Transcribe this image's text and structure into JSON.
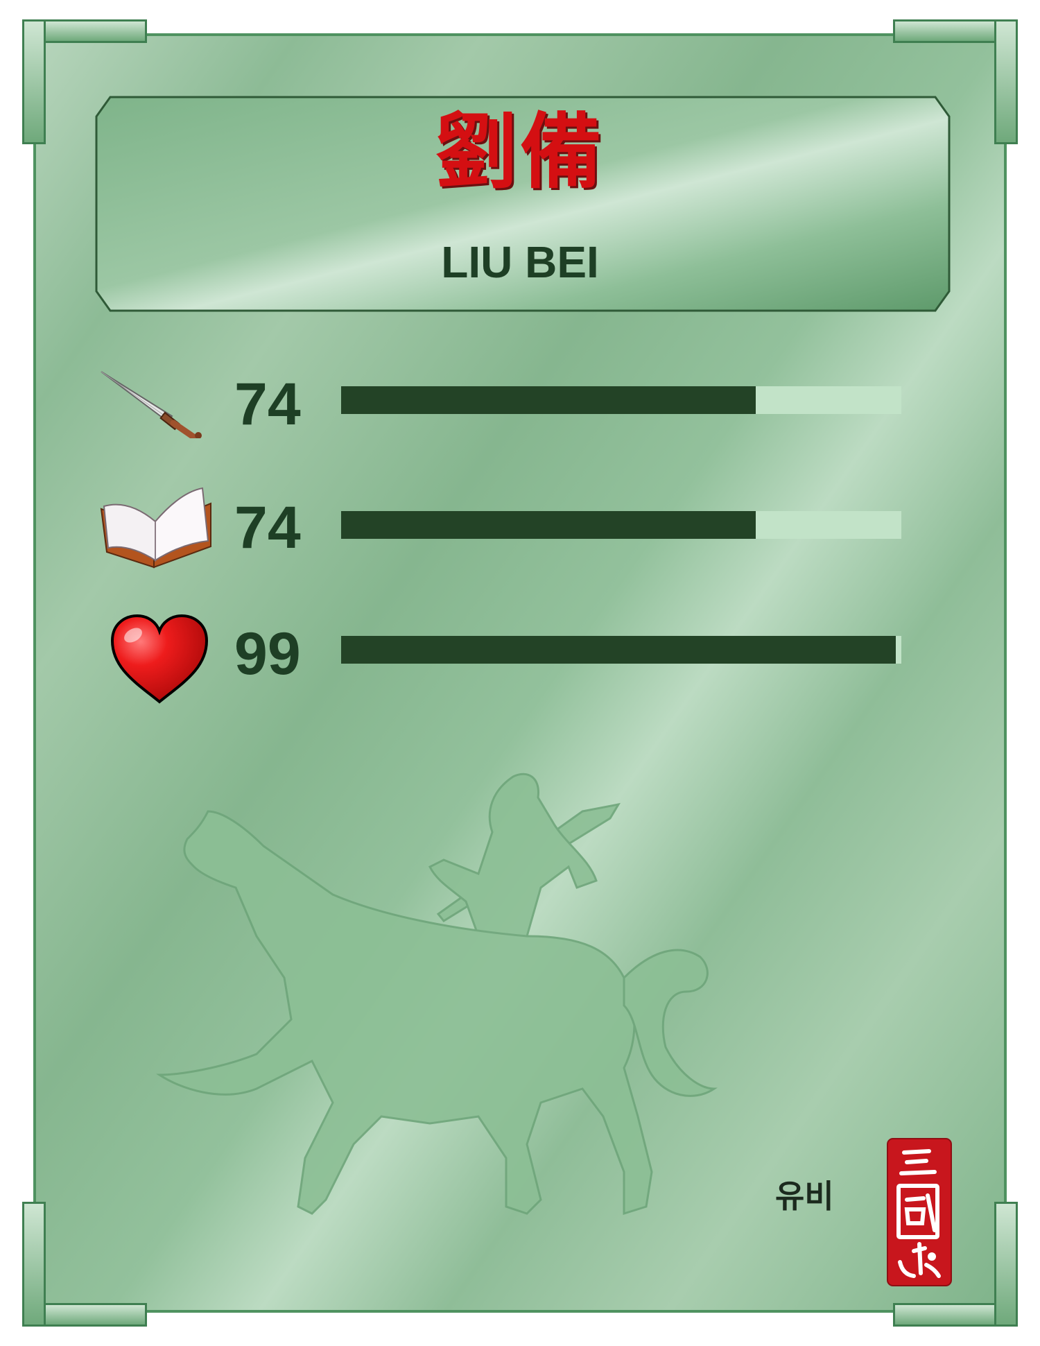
{
  "card": {
    "name_chinese": "劉備",
    "name_english": "LIU BEI",
    "name_korean": "유비",
    "seal_text": "三國志"
  },
  "stats": [
    {
      "icon": "sword-icon",
      "value": "74",
      "fraction": 0.74
    },
    {
      "icon": "book-icon",
      "value": "74",
      "fraction": 0.74
    },
    {
      "icon": "heart-icon",
      "value": "99",
      "fraction": 0.99
    }
  ],
  "colors": {
    "card_green": "#8dbb96",
    "name_red": "#d40f12",
    "dark_green": "#234326",
    "bar_track": "#c2e3c8",
    "seal_red": "#c8161d"
  }
}
